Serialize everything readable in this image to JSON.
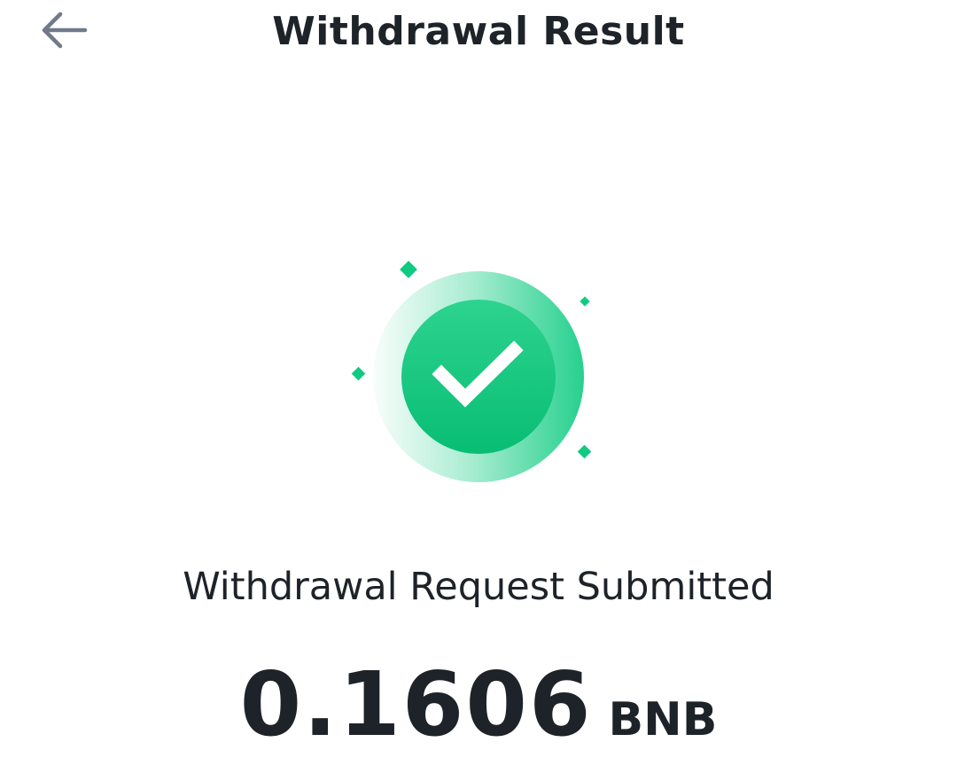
{
  "header": {
    "back_icon": "arrow-left-icon",
    "title": "Withdrawal Result"
  },
  "result": {
    "icon": "check-circle-icon",
    "accent_color": "#0ecb81",
    "status_text": "Withdrawal Request Submitted",
    "amount": "0.1606",
    "currency": "BNB"
  }
}
